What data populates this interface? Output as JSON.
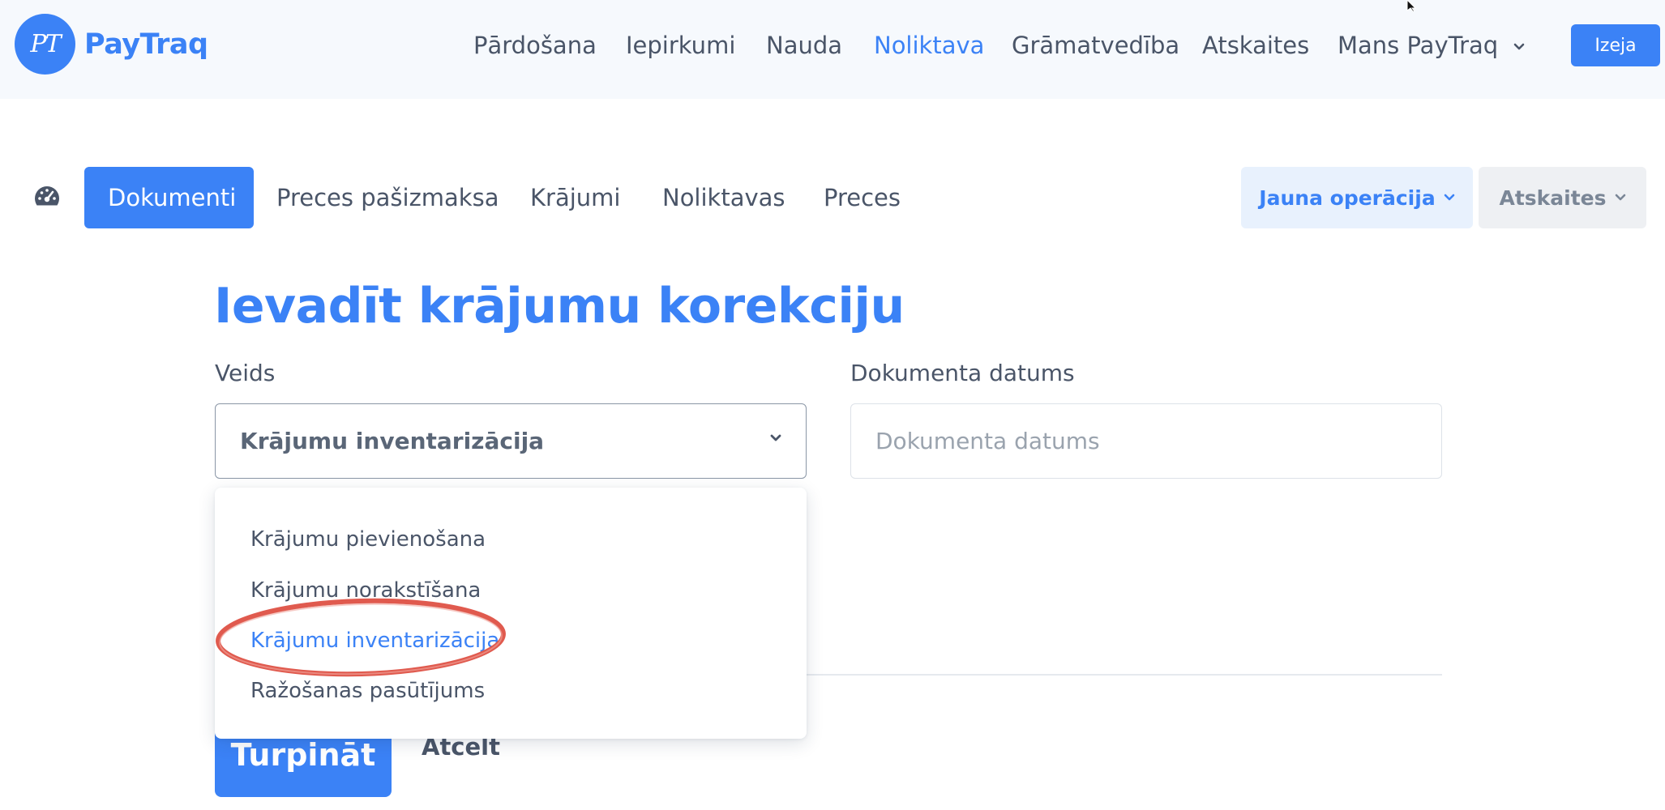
{
  "app": {
    "logo_mark": "PT",
    "logo_text": "PayTraq"
  },
  "main_nav": {
    "items": [
      {
        "label": "Pārdošana"
      },
      {
        "label": "Iepirkumi"
      },
      {
        "label": "Nauda"
      },
      {
        "label": "Noliktava",
        "active": true
      },
      {
        "label": "Grāmatvedība"
      },
      {
        "label": "Atskaites"
      },
      {
        "label": "Mans PayTraq",
        "has_dropdown": true
      }
    ],
    "exit_label": "Izeja"
  },
  "sub_nav": {
    "dashboard_icon": "speedometer-icon",
    "items": [
      {
        "label": "Dokumenti",
        "active": true
      },
      {
        "label": "Preces pašizmaksa"
      },
      {
        "label": "Krājumi"
      },
      {
        "label": "Noliktavas"
      },
      {
        "label": "Preces"
      }
    ],
    "new_operation_label": "Jauna operācija",
    "reports_label": "Atskaites"
  },
  "form": {
    "title": "Ievadīt krājumu korekciju",
    "type_label": "Veids",
    "type_value": "Krājumu inventarizācija",
    "date_label": "Dokumenta datums",
    "date_placeholder": "Dokumenta datums",
    "date_value": "",
    "continue_label": "Turpināt",
    "cancel_label": "Atcelt"
  },
  "dropdown": {
    "options": [
      {
        "label": "Krājumu pievienošana"
      },
      {
        "label": "Krājumu norakstīšana"
      },
      {
        "label": "Krājumu inventarizācija",
        "selected": true
      },
      {
        "label": "Ražošanas pasūtījums"
      }
    ],
    "highlight_color": "#e05a4e"
  },
  "colors": {
    "accent": "#3b82f6",
    "text": "#4a5568",
    "topbar_bg": "#f6f9fd"
  }
}
